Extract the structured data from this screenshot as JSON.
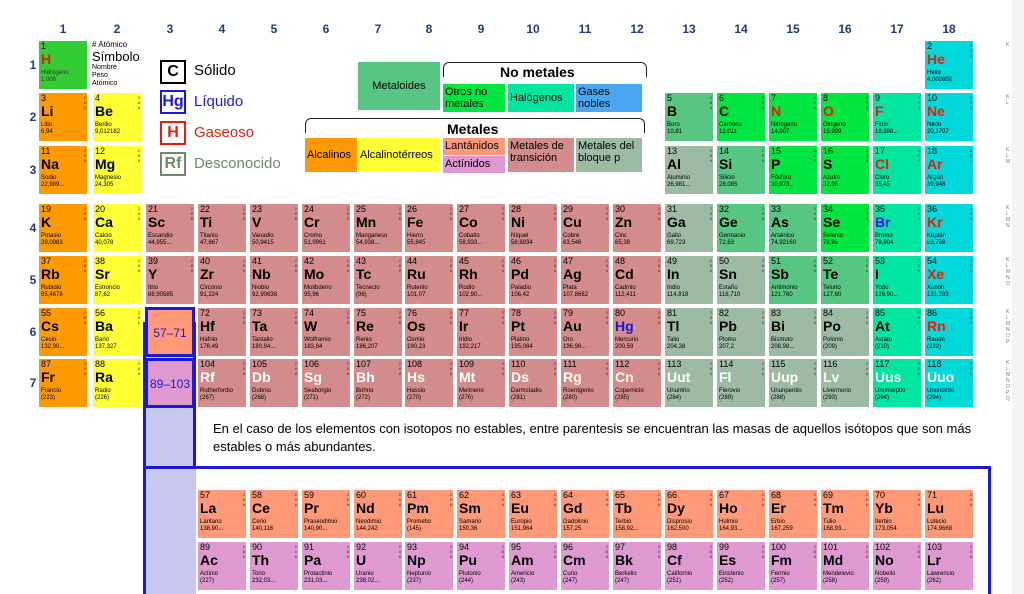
{
  "colors": {
    "hydrogen": "#33cc33",
    "alkali": "#ff9900",
    "alkaline": "#ffff33",
    "transition": "#d48b8b",
    "metalloid": "#58c683",
    "other_nonmetal": "#00e640",
    "halogen": "#00e6a0",
    "noble": "#00d9d9",
    "poor_metal": "#9dbba3",
    "lanthanide": "#ff9977",
    "actinide": "#de9ad0",
    "unknown": "#d9a3a3",
    "frame": "#1a1ad6"
  },
  "columns": [
    "1",
    "2",
    "3",
    "4",
    "5",
    "6",
    "7",
    "8",
    "9",
    "10",
    "11",
    "12",
    "13",
    "14",
    "15",
    "16",
    "17",
    "18"
  ],
  "periods": [
    "1",
    "2",
    "3",
    "4",
    "5",
    "6",
    "7"
  ],
  "key_cell": {
    "z": "1",
    "s": "H",
    "n": "Hidrógeno",
    "m": "1,008"
  },
  "key_labels": {
    "atomic": "# Atómico",
    "symbol": "Símbolo",
    "name": "Nombre",
    "weight": "Peso Atómico"
  },
  "legend": [
    {
      "sym": "C",
      "label": "Sólido"
    },
    {
      "sym": "Hg",
      "label": "Líquido"
    },
    {
      "sym": "H",
      "label": "Gaseoso"
    },
    {
      "sym": "Rf",
      "label": "Desconocido"
    }
  ],
  "categories": {
    "nonmetals_title": "No metales",
    "metals_title": "Metales",
    "metalloids": "Metaloides",
    "other_nonmetals": "Otros no metales",
    "halogens": "Halógenos",
    "noble_gases": "Gases nobles",
    "alkali": "Alcalinos",
    "alkaline_earth": "Alcalinotérreos",
    "lanthanides": "Lantánidos",
    "actinides": "Actínidos",
    "transition": "Metales de transición",
    "p_block": "Metales del bloque p"
  },
  "placeholders": {
    "lanthanides": "57–71",
    "actinides": "89–103"
  },
  "note": "En el caso de los elementos con isotopos no estables, entre parentesis se encuentran las masas de aquellos isótopos que son más estables o más abundantes.",
  "shell_labels": {
    "p1": "K",
    "p2": "K\nL",
    "p3": "K\nL\nM",
    "p4": "K\nL\nM\nN",
    "p5": "K\nL\nM\nN\nO",
    "p6": "K\nL\nM\nN\nO\nP",
    "p7": "K\nL\nM\nN\nO\nP\nQ"
  },
  "elements": [
    {
      "z": "1",
      "s": "H",
      "n": "Hidrógeno",
      "m": "1,008",
      "c": "hydrogen"
    },
    {
      "z": "2",
      "s": "He",
      "n": "Helio",
      "m": "4,002602",
      "c": "noble"
    },
    {
      "z": "3",
      "s": "Li",
      "n": "Litio",
      "m": "6,94",
      "c": "alkali"
    },
    {
      "z": "4",
      "s": "Be",
      "n": "Berilio",
      "m": "9,012182",
      "c": "alkaline"
    },
    {
      "z": "5",
      "s": "B",
      "n": "Boro",
      "m": "10,81",
      "c": "metalloid"
    },
    {
      "z": "6",
      "s": "C",
      "n": "Carbono",
      "m": "12,011",
      "c": "other_nonmetal"
    },
    {
      "z": "7",
      "s": "N",
      "n": "Nitrógeno",
      "m": "14,007",
      "c": "other_nonmetal"
    },
    {
      "z": "8",
      "s": "O",
      "n": "Oxígeno",
      "m": "15,999",
      "c": "other_nonmetal"
    },
    {
      "z": "9",
      "s": "F",
      "n": "Flúor",
      "m": "18,998...",
      "c": "halogen"
    },
    {
      "z": "10",
      "s": "Ne",
      "n": "Neón",
      "m": "20,1797",
      "c": "noble"
    },
    {
      "z": "11",
      "s": "Na",
      "n": "Sodio",
      "m": "22,989...",
      "c": "alkali"
    },
    {
      "z": "12",
      "s": "Mg",
      "n": "Magnesio",
      "m": "24,305",
      "c": "alkaline"
    },
    {
      "z": "13",
      "s": "Al",
      "n": "Aluminio",
      "m": "26,981...",
      "c": "poor_metal"
    },
    {
      "z": "14",
      "s": "Si",
      "n": "Silicio",
      "m": "28,085",
      "c": "metalloid"
    },
    {
      "z": "15",
      "s": "P",
      "n": "Fósforo",
      "m": "30,973...",
      "c": "other_nonmetal"
    },
    {
      "z": "16",
      "s": "S",
      "n": "Azufre",
      "m": "32,06",
      "c": "other_nonmetal"
    },
    {
      "z": "17",
      "s": "Cl",
      "n": "Cloro",
      "m": "35,45",
      "c": "halogen"
    },
    {
      "z": "18",
      "s": "Ar",
      "n": "Argón",
      "m": "39,948",
      "c": "noble"
    },
    {
      "z": "19",
      "s": "K",
      "n": "Potasio",
      "m": "39,0983",
      "c": "alkali"
    },
    {
      "z": "20",
      "s": "Ca",
      "n": "Calcio",
      "m": "40,078",
      "c": "alkaline"
    },
    {
      "z": "21",
      "s": "Sc",
      "n": "Escandio",
      "m": "44,955...",
      "c": "transition"
    },
    {
      "z": "22",
      "s": "Ti",
      "n": "Titanio",
      "m": "47,867",
      "c": "transition"
    },
    {
      "z": "23",
      "s": "V",
      "n": "Vanadio",
      "m": "50,9415",
      "c": "transition"
    },
    {
      "z": "24",
      "s": "Cr",
      "n": "Cromo",
      "m": "51,9961",
      "c": "transition"
    },
    {
      "z": "25",
      "s": "Mn",
      "n": "Manganeso",
      "m": "54,938...",
      "c": "transition"
    },
    {
      "z": "26",
      "s": "Fe",
      "n": "Hierro",
      "m": "55,845",
      "c": "transition"
    },
    {
      "z": "27",
      "s": "Co",
      "n": "Cobalto",
      "m": "58,933...",
      "c": "transition"
    },
    {
      "z": "28",
      "s": "Ni",
      "n": "Níquel",
      "m": "58,6934",
      "c": "transition"
    },
    {
      "z": "29",
      "s": "Cu",
      "n": "Cobre",
      "m": "63,546",
      "c": "transition"
    },
    {
      "z": "30",
      "s": "Zn",
      "n": "Cinc",
      "m": "65,38",
      "c": "transition"
    },
    {
      "z": "31",
      "s": "Ga",
      "n": "Galio",
      "m": "69,723",
      "c": "poor_metal"
    },
    {
      "z": "32",
      "s": "Ge",
      "n": "Germanio",
      "m": "72,63",
      "c": "metalloid"
    },
    {
      "z": "33",
      "s": "As",
      "n": "Arsénico",
      "m": "74,92160",
      "c": "metalloid"
    },
    {
      "z": "34",
      "s": "Se",
      "n": "Selenio",
      "m": "78,96",
      "c": "other_nonmetal"
    },
    {
      "z": "35",
      "s": "Br",
      "n": "Bromo",
      "m": "79,904",
      "c": "halogen"
    },
    {
      "z": "36",
      "s": "Kr",
      "n": "Kriptón",
      "m": "83,798",
      "c": "noble"
    },
    {
      "z": "37",
      "s": "Rb",
      "n": "Rubidio",
      "m": "85,4678",
      "c": "alkali"
    },
    {
      "z": "38",
      "s": "Sr",
      "n": "Estroncio",
      "m": "87,62",
      "c": "alkaline"
    },
    {
      "z": "39",
      "s": "Y",
      "n": "Itrio",
      "m": "88,90585",
      "c": "transition"
    },
    {
      "z": "40",
      "s": "Zr",
      "n": "Circonio",
      "m": "91,224",
      "c": "transition"
    },
    {
      "z": "41",
      "s": "Nb",
      "n": "Niobio",
      "m": "92,90638",
      "c": "transition"
    },
    {
      "z": "42",
      "s": "Mo",
      "n": "Molibdeno",
      "m": "95,96",
      "c": "transition"
    },
    {
      "z": "43",
      "s": "Tc",
      "n": "Tecnecio",
      "m": "(98)",
      "c": "transition"
    },
    {
      "z": "44",
      "s": "Ru",
      "n": "Rutenio",
      "m": "101,07",
      "c": "transition"
    },
    {
      "z": "45",
      "s": "Rh",
      "n": "Rodio",
      "m": "102,90...",
      "c": "transition"
    },
    {
      "z": "46",
      "s": "Pd",
      "n": "Paladio",
      "m": "106,42",
      "c": "transition"
    },
    {
      "z": "47",
      "s": "Ag",
      "n": "Plata",
      "m": "107,8682",
      "c": "transition"
    },
    {
      "z": "48",
      "s": "Cd",
      "n": "Cadmio",
      "m": "112,411",
      "c": "transition"
    },
    {
      "z": "49",
      "s": "In",
      "n": "Indio",
      "m": "114,818",
      "c": "poor_metal"
    },
    {
      "z": "50",
      "s": "Sn",
      "n": "Estaño",
      "m": "118,710",
      "c": "poor_metal"
    },
    {
      "z": "51",
      "s": "Sb",
      "n": "Antimonio",
      "m": "121,760",
      "c": "metalloid"
    },
    {
      "z": "52",
      "s": "Te",
      "n": "Telurio",
      "m": "127,60",
      "c": "metalloid"
    },
    {
      "z": "53",
      "s": "I",
      "n": "Yodo",
      "m": "126,90...",
      "c": "halogen"
    },
    {
      "z": "54",
      "s": "Xe",
      "n": "Xenón",
      "m": "131,293",
      "c": "noble"
    },
    {
      "z": "55",
      "s": "Cs",
      "n": "Cesio",
      "m": "132,90...",
      "c": "alkali"
    },
    {
      "z": "56",
      "s": "Ba",
      "n": "Bario",
      "m": "137,327",
      "c": "alkaline"
    },
    {
      "z": "72",
      "s": "Hf",
      "n": "Hafnio",
      "m": "178,49",
      "c": "transition"
    },
    {
      "z": "73",
      "s": "Ta",
      "n": "Tantalio",
      "m": "180,94...",
      "c": "transition"
    },
    {
      "z": "74",
      "s": "W",
      "n": "Wolframio",
      "m": "183,84",
      "c": "transition"
    },
    {
      "z": "75",
      "s": "Re",
      "n": "Renio",
      "m": "186,207",
      "c": "transition"
    },
    {
      "z": "76",
      "s": "Os",
      "n": "Osmio",
      "m": "190,23",
      "c": "transition"
    },
    {
      "z": "77",
      "s": "Ir",
      "n": "Iridio",
      "m": "192,217",
      "c": "transition"
    },
    {
      "z": "78",
      "s": "Pt",
      "n": "Platino",
      "m": "195,084",
      "c": "transition"
    },
    {
      "z": "79",
      "s": "Au",
      "n": "Oro",
      "m": "196,96...",
      "c": "transition"
    },
    {
      "z": "80",
      "s": "Hg",
      "n": "Mercurio",
      "m": "200,59",
      "c": "transition",
      "state": "liquid"
    },
    {
      "z": "81",
      "s": "Tl",
      "n": "Talio",
      "m": "204,38",
      "c": "poor_metal"
    },
    {
      "z": "82",
      "s": "Pb",
      "n": "Plomo",
      "m": "207,2",
      "c": "poor_metal"
    },
    {
      "z": "83",
      "s": "Bi",
      "n": "Bismuto",
      "m": "208,98...",
      "c": "poor_metal"
    },
    {
      "z": "84",
      "s": "Po",
      "n": "Polonio",
      "m": "(209)",
      "c": "poor_metal"
    },
    {
      "z": "85",
      "s": "At",
      "n": "Astato",
      "m": "(210)",
      "c": "halogen"
    },
    {
      "z": "86",
      "s": "Rn",
      "n": "Radón",
      "m": "(222)",
      "c": "noble"
    },
    {
      "z": "87",
      "s": "Fr",
      "n": "Francio",
      "m": "(223)",
      "c": "alkali"
    },
    {
      "z": "88",
      "s": "Ra",
      "n": "Radio",
      "m": "(226)",
      "c": "alkaline"
    },
    {
      "z": "104",
      "s": "Rf",
      "n": "Rutherfordio",
      "m": "(267)",
      "c": "transition",
      "state": "unknown"
    },
    {
      "z": "105",
      "s": "Db",
      "n": "Dubnio",
      "m": "(268)",
      "c": "transition",
      "state": "unknown"
    },
    {
      "z": "106",
      "s": "Sg",
      "n": "Seaborgio",
      "m": "(271)",
      "c": "transition",
      "state": "unknown"
    },
    {
      "z": "107",
      "s": "Bh",
      "n": "Bohrio",
      "m": "(272)",
      "c": "transition",
      "state": "unknown"
    },
    {
      "z": "108",
      "s": "Hs",
      "n": "Hassio",
      "m": "(270)",
      "c": "transition",
      "state": "unknown"
    },
    {
      "z": "109",
      "s": "Mt",
      "n": "Meitnerio",
      "m": "(276)",
      "c": "transition",
      "state": "unknown"
    },
    {
      "z": "110",
      "s": "Ds",
      "n": "Darmstadio",
      "m": "(281)",
      "c": "transition",
      "state": "unknown"
    },
    {
      "z": "111",
      "s": "Rg",
      "n": "Roentgenio",
      "m": "(280)",
      "c": "transition",
      "state": "unknown"
    },
    {
      "z": "112",
      "s": "Cn",
      "n": "Copernicio",
      "m": "(285)",
      "c": "transition",
      "state": "unknown"
    },
    {
      "z": "113",
      "s": "Uut",
      "n": "Ununtrio",
      "m": "(284)",
      "c": "poor_metal",
      "state": "unknown"
    },
    {
      "z": "114",
      "s": "Fl",
      "n": "Flerovio",
      "m": "(289)",
      "c": "poor_metal",
      "state": "unknown"
    },
    {
      "z": "115",
      "s": "Uup",
      "n": "Ununpentio",
      "m": "(288)",
      "c": "poor_metal",
      "state": "unknown"
    },
    {
      "z": "116",
      "s": "Lv",
      "n": "Livermorio",
      "m": "(293)",
      "c": "poor_metal",
      "state": "unknown"
    },
    {
      "z": "117",
      "s": "Uus",
      "n": "Ununseptio",
      "m": "(294)",
      "c": "halogen",
      "state": "unknown"
    },
    {
      "z": "118",
      "s": "Uuo",
      "n": "Ununoctio",
      "m": "(294)",
      "c": "noble",
      "state": "unknown"
    },
    {
      "z": "57",
      "s": "La",
      "n": "Lantano",
      "m": "138,90...",
      "c": "lanthanide"
    },
    {
      "z": "58",
      "s": "Ce",
      "n": "Cerio",
      "m": "140,116",
      "c": "lanthanide"
    },
    {
      "z": "59",
      "s": "Pr",
      "n": "Praseodimio",
      "m": "140,90...",
      "c": "lanthanide"
    },
    {
      "z": "60",
      "s": "Nd",
      "n": "Neodimio",
      "m": "144,242",
      "c": "lanthanide"
    },
    {
      "z": "61",
      "s": "Pm",
      "n": "Prometio",
      "m": "(145)",
      "c": "lanthanide"
    },
    {
      "z": "62",
      "s": "Sm",
      "n": "Samario",
      "m": "150,36",
      "c": "lanthanide"
    },
    {
      "z": "63",
      "s": "Eu",
      "n": "Europio",
      "m": "151,964",
      "c": "lanthanide"
    },
    {
      "z": "64",
      "s": "Gd",
      "n": "Gadolinio",
      "m": "157,25",
      "c": "lanthanide"
    },
    {
      "z": "65",
      "s": "Tb",
      "n": "Terbio",
      "m": "158,92...",
      "c": "lanthanide"
    },
    {
      "z": "66",
      "s": "Dy",
      "n": "Disprosio",
      "m": "162,500",
      "c": "lanthanide"
    },
    {
      "z": "67",
      "s": "Ho",
      "n": "Holmio",
      "m": "164,93...",
      "c": "lanthanide"
    },
    {
      "z": "68",
      "s": "Er",
      "n": "Erbio",
      "m": "167,259",
      "c": "lanthanide"
    },
    {
      "z": "69",
      "s": "Tm",
      "n": "Tulio",
      "m": "168,93...",
      "c": "lanthanide"
    },
    {
      "z": "70",
      "s": "Yb",
      "n": "Iterbio",
      "m": "173,054",
      "c": "lanthanide"
    },
    {
      "z": "71",
      "s": "Lu",
      "n": "Lutecio",
      "m": "174,9668",
      "c": "lanthanide"
    },
    {
      "z": "89",
      "s": "Ac",
      "n": "Actinio",
      "m": "(227)",
      "c": "actinide"
    },
    {
      "z": "90",
      "s": "Th",
      "n": "Torio",
      "m": "232,03...",
      "c": "actinide"
    },
    {
      "z": "91",
      "s": "Pa",
      "n": "Protactinio",
      "m": "231,03...",
      "c": "actinide"
    },
    {
      "z": "92",
      "s": "U",
      "n": "Uranio",
      "m": "238,02...",
      "c": "actinide"
    },
    {
      "z": "93",
      "s": "Np",
      "n": "Neptunio",
      "m": "(237)",
      "c": "actinide"
    },
    {
      "z": "94",
      "s": "Pu",
      "n": "Plutonio",
      "m": "(244)",
      "c": "actinide"
    },
    {
      "z": "95",
      "s": "Am",
      "n": "Americio",
      "m": "(243)",
      "c": "actinide"
    },
    {
      "z": "96",
      "s": "Cm",
      "n": "Curio",
      "m": "(247)",
      "c": "actinide"
    },
    {
      "z": "97",
      "s": "Bk",
      "n": "Berkelio",
      "m": "(247)",
      "c": "actinide"
    },
    {
      "z": "98",
      "s": "Cf",
      "n": "Californio",
      "m": "(251)",
      "c": "actinide"
    },
    {
      "z": "99",
      "s": "Es",
      "n": "Einstenio",
      "m": "(252)",
      "c": "actinide"
    },
    {
      "z": "100",
      "s": "Fm",
      "n": "Fermio",
      "m": "(257)",
      "c": "actinide"
    },
    {
      "z": "101",
      "s": "Md",
      "n": "Mendelevio",
      "m": "(258)",
      "c": "actinide"
    },
    {
      "z": "102",
      "s": "No",
      "n": "Nobelio",
      "m": "(259)",
      "c": "actinide"
    },
    {
      "z": "103",
      "s": "Lr",
      "n": "Lawrencio",
      "m": "(262)",
      "c": "actinide"
    }
  ]
}
